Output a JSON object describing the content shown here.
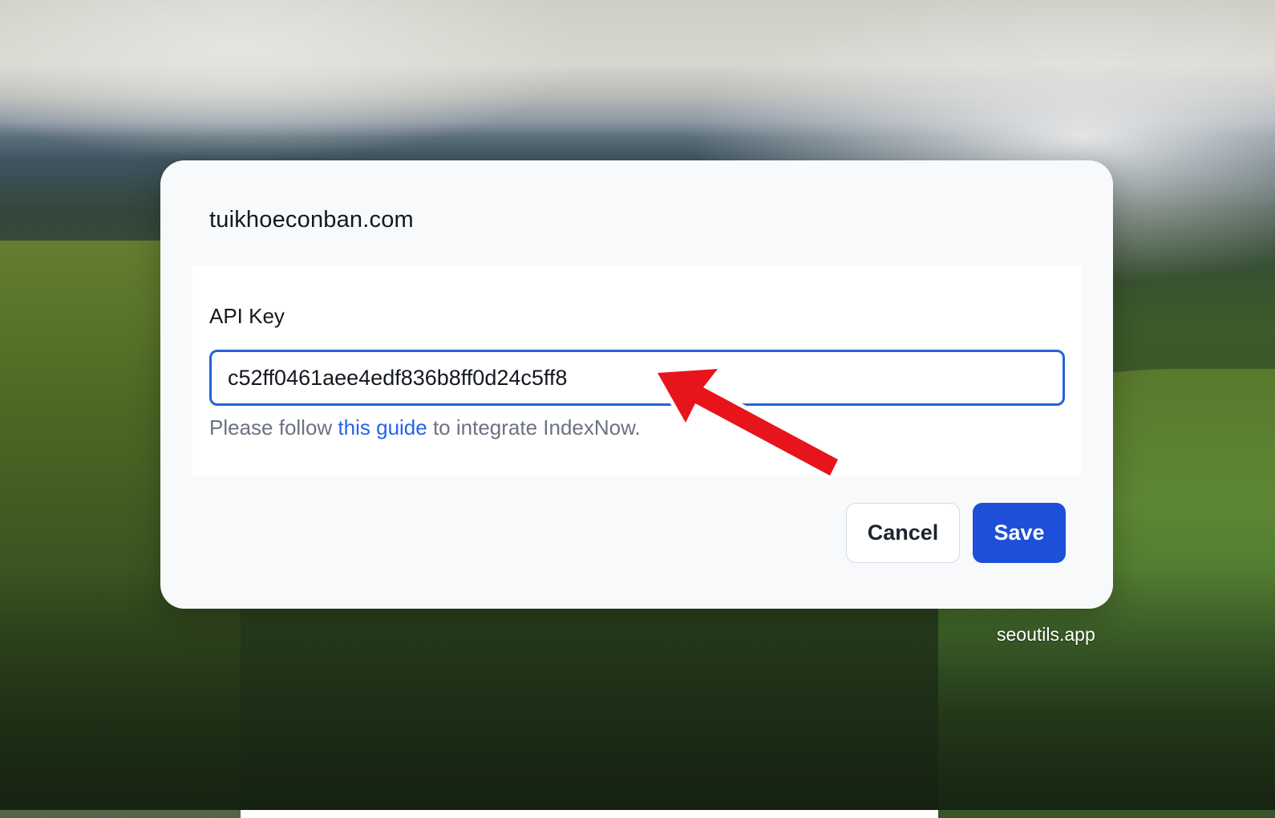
{
  "dialog": {
    "title": "tuikhoeconban.com",
    "field_label": "API Key",
    "api_key_value": "c52ff0461aee4edf836b8ff0d24c5ff8",
    "help_prefix": "Please follow ",
    "help_link": "this guide",
    "help_suffix": " to integrate IndexNow.",
    "cancel_label": "Cancel",
    "save_label": "Save"
  },
  "annotation": {
    "arrow_color": "#e8141b",
    "icon": "red-arrow-icon"
  },
  "footer": {
    "watermark": "seoutils.app"
  },
  "colors": {
    "accent": "#1d4fd8",
    "focus_border": "#2563d9",
    "link": "#2563eb"
  }
}
